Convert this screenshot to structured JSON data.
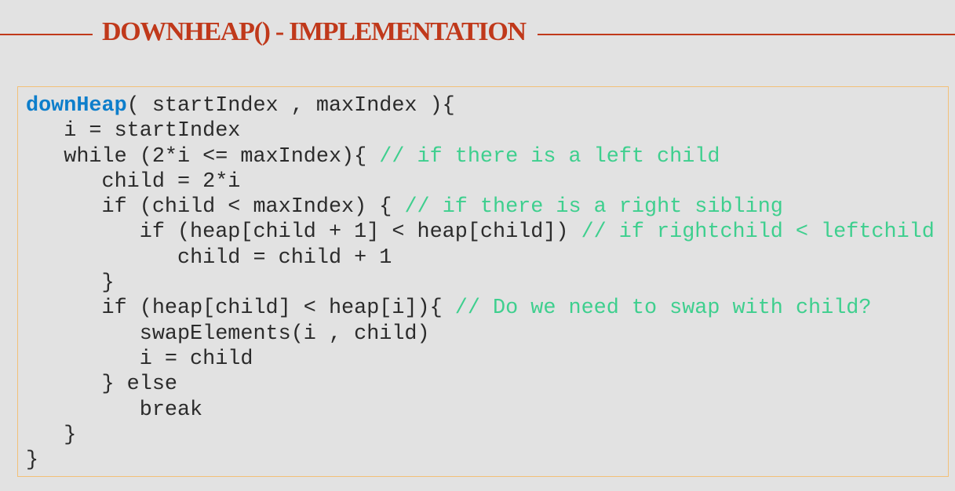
{
  "slide": {
    "title": "DOWNHEAP() - IMPLEMENTATION"
  },
  "colors": {
    "title": "#c0391b",
    "function_name": "#0d7ecb",
    "comment": "#3ecf8e",
    "code_text": "#2b2b2b",
    "box_border": "#f2c078",
    "background": "#e2e2e2"
  },
  "code": {
    "lines": [
      {
        "indent": "",
        "fn": "downHeap",
        "code": "( startIndex , maxIndex ){",
        "comment": ""
      },
      {
        "indent": "   ",
        "fn": "",
        "code": "i = startIndex",
        "comment": ""
      },
      {
        "indent": "   ",
        "fn": "",
        "code": "while (2*i <= maxIndex){ ",
        "comment": "// if there is a left child"
      },
      {
        "indent": "      ",
        "fn": "",
        "code": "child = 2*i",
        "comment": ""
      },
      {
        "indent": "      ",
        "fn": "",
        "code": "if (child < maxIndex) { ",
        "comment": "// if there is a right sibling"
      },
      {
        "indent": "         ",
        "fn": "",
        "code": "if (heap[child + 1] < heap[child]) ",
        "comment": "// if rightchild < leftchild"
      },
      {
        "indent": "            ",
        "fn": "",
        "code": "child = child + 1",
        "comment": ""
      },
      {
        "indent": "      ",
        "fn": "",
        "code": "}",
        "comment": ""
      },
      {
        "indent": "      ",
        "fn": "",
        "code": "if (heap[child] < heap[i]){ ",
        "comment": "// Do we need to swap with child?"
      },
      {
        "indent": "         ",
        "fn": "",
        "code": "swapElements(i , child)",
        "comment": ""
      },
      {
        "indent": "         ",
        "fn": "",
        "code": "i = child",
        "comment": ""
      },
      {
        "indent": "      ",
        "fn": "",
        "code": "} else",
        "comment": ""
      },
      {
        "indent": "         ",
        "fn": "",
        "code": "break",
        "comment": ""
      },
      {
        "indent": "   ",
        "fn": "",
        "code": "}",
        "comment": ""
      },
      {
        "indent": "",
        "fn": "",
        "code": "}",
        "comment": ""
      }
    ]
  }
}
